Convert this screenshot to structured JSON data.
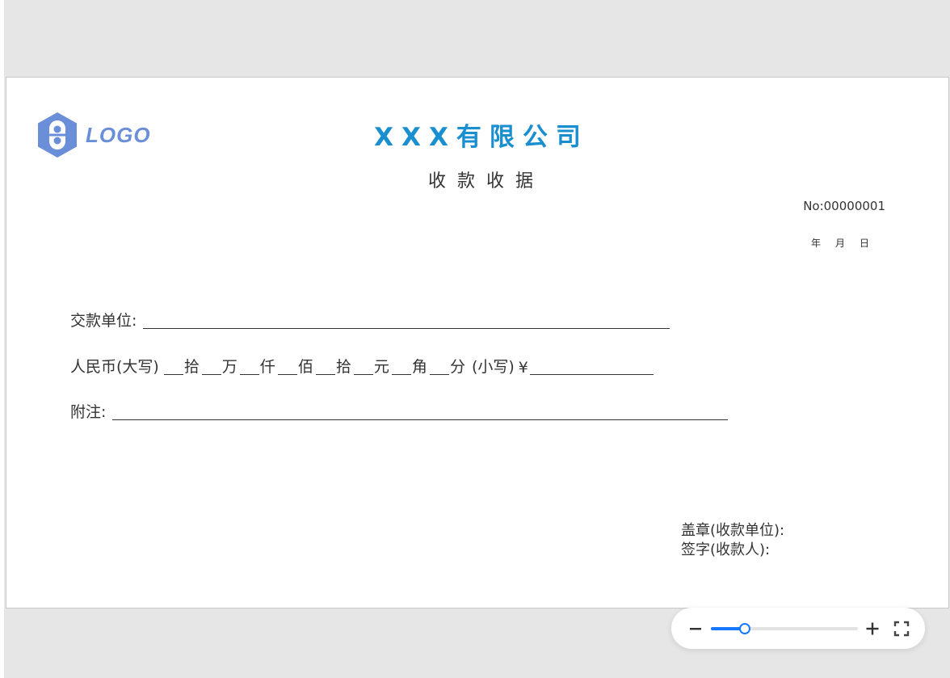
{
  "receipt": {
    "logo_text": "LOGO",
    "company_name": "XXX有限公司",
    "doc_title": "收款收据",
    "number": "No:00000001",
    "date_year": "年",
    "date_month": "月",
    "date_day": "日",
    "payer_label": "交款单位:",
    "rmb_upper_label": "人民币(大写)",
    "amount_units": [
      "拾",
      "万",
      "仟",
      "佰",
      "拾",
      "元",
      "角",
      "分"
    ],
    "rmb_lower_label": "(小写)",
    "yen_symbol": "¥",
    "remark_label": "附注:",
    "seal_label": "盖章(收款单位):",
    "signature_label": "签字(收款人):"
  },
  "colors": {
    "brand_blue": "#1a8fd0",
    "logo_blue": "#6a8fd8",
    "slider_accent": "#1677ff",
    "background": "#e6e6e6"
  },
  "zoom": {
    "level_fraction": 0.23,
    "icons": [
      "minus-icon",
      "plus-icon",
      "fullscreen-icon"
    ]
  }
}
